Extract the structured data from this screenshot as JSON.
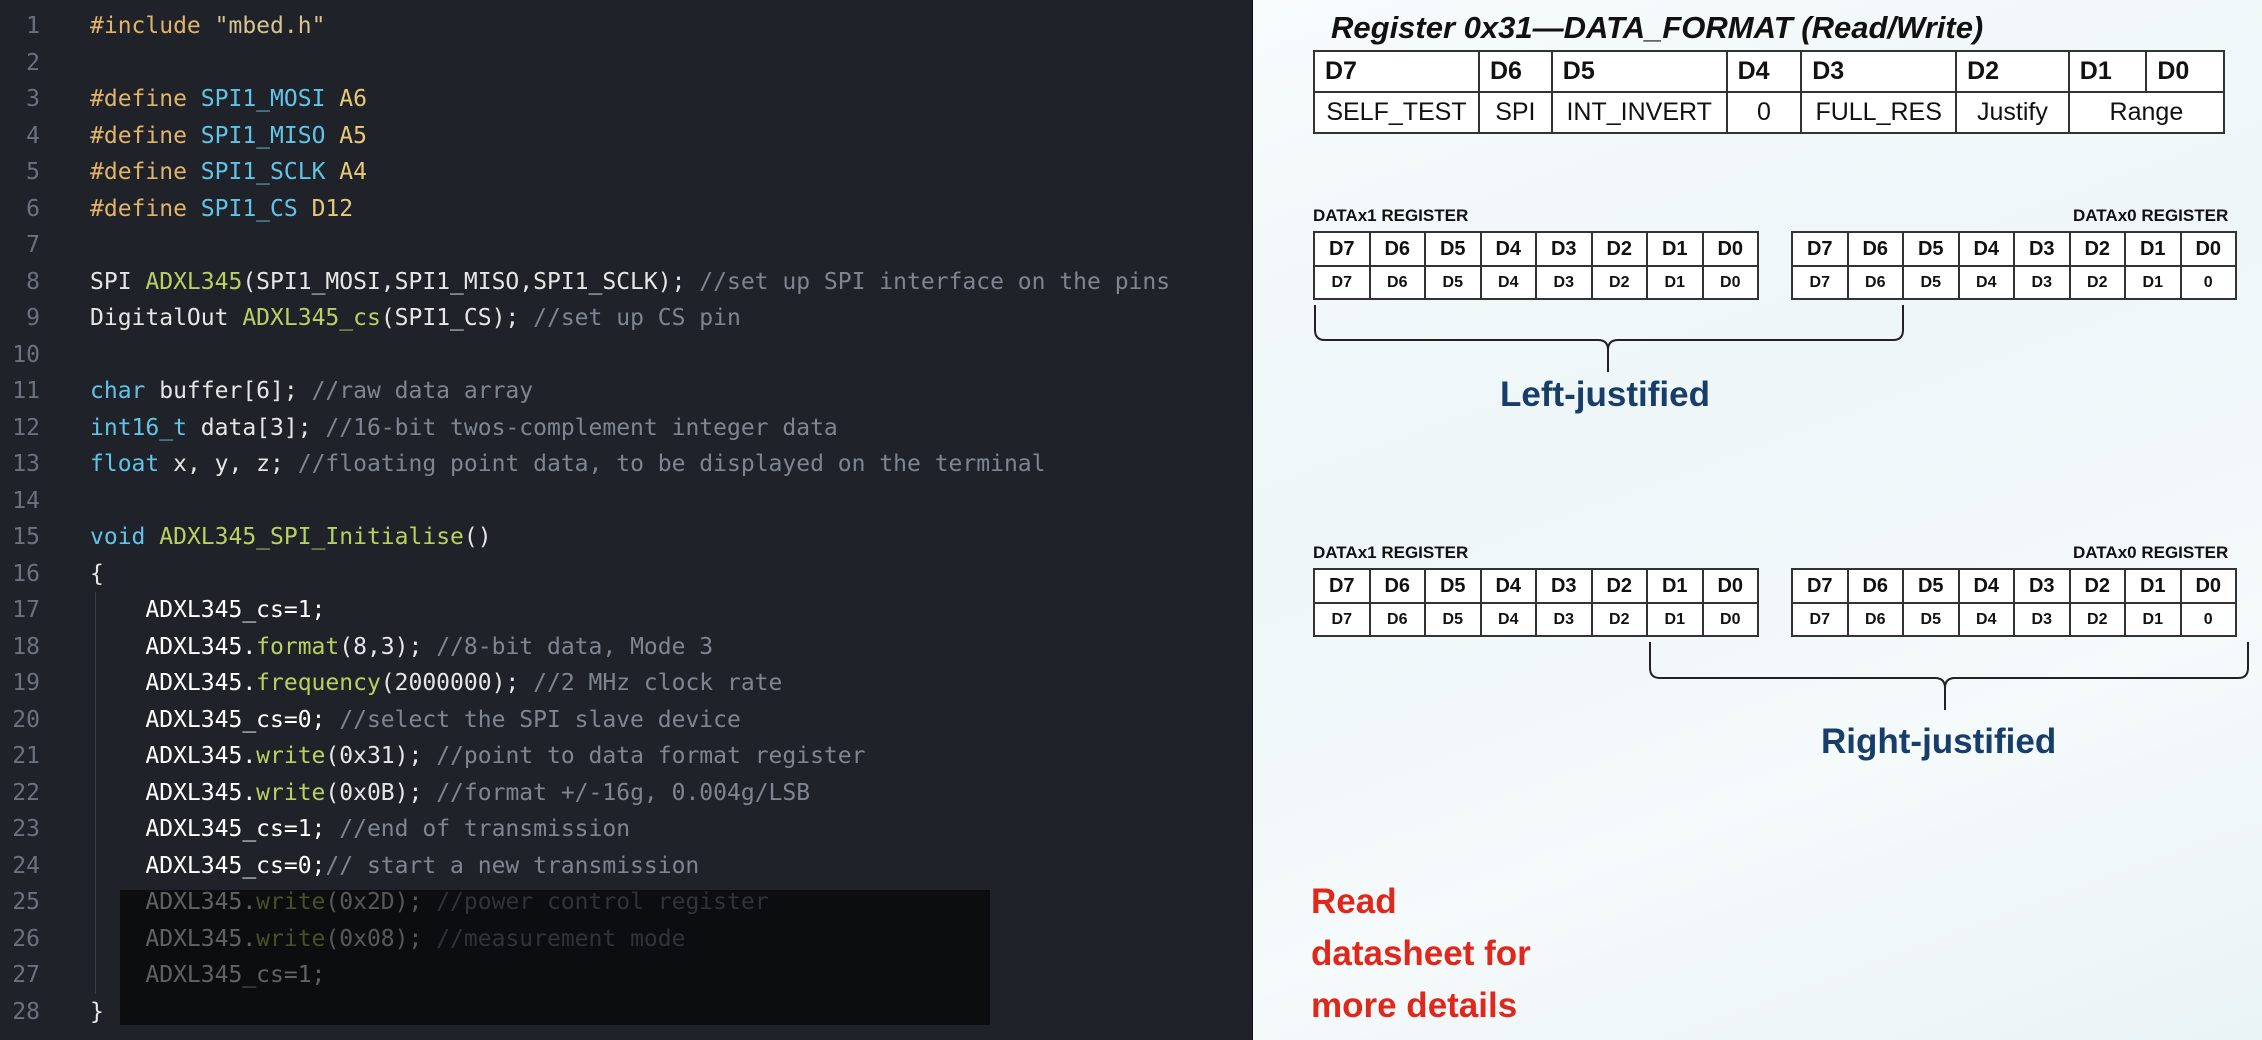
{
  "editor": {
    "lines": [
      {
        "n": "1",
        "html": "<span class=\"pp\">#include</span> <span class=\"str\">\"mbed.h\"</span>"
      },
      {
        "n": "2",
        "html": ""
      },
      {
        "n": "3",
        "html": "<span class=\"pp\">#define</span> <span class=\"mac\">SPI1_MOSI</span> <span class=\"num\">A6</span>"
      },
      {
        "n": "4",
        "html": "<span class=\"pp\">#define</span> <span class=\"mac\">SPI1_MISO</span> <span class=\"num\">A5</span>"
      },
      {
        "n": "5",
        "html": "<span class=\"pp\">#define</span> <span class=\"mac\">SPI1_SCLK</span> <span class=\"num\">A4</span>"
      },
      {
        "n": "6",
        "html": "<span class=\"pp\">#define</span> <span class=\"mac\">SPI1_CS</span> <span class=\"num\">D12</span>"
      },
      {
        "n": "7",
        "html": ""
      },
      {
        "n": "8",
        "html": "SPI <span class=\"fn\">ADXL345</span>(SPI1_MOSI,SPI1_MISO,SPI1_SCLK); <span class=\"cm\">//set up SPI interface on the pins</span>"
      },
      {
        "n": "9",
        "html": "DigitalOut <span class=\"fn\">ADXL345_cs</span>(SPI1_CS); <span class=\"cm\">//set up CS pin</span>"
      },
      {
        "n": "10",
        "html": ""
      },
      {
        "n": "11",
        "html": "<span class=\"kw\">char</span> buffer[6]; <span class=\"cm\">//raw data array</span>"
      },
      {
        "n": "12",
        "html": "<span class=\"kw\">int16_t</span> data[3]; <span class=\"cm\">//16-bit twos-complement integer data</span>"
      },
      {
        "n": "13",
        "html": "<span class=\"kw\">float</span> x, y, z; <span class=\"cm\">//floating point data, to be displayed on the terminal</span>"
      },
      {
        "n": "14",
        "html": ""
      },
      {
        "n": "15",
        "html": "<span class=\"kw\">void</span> <span class=\"fn\">ADXL345_SPI_Initialise</span>()"
      },
      {
        "n": "16",
        "html": "{"
      },
      {
        "n": "17",
        "html": "    <span class=\"hl\">ADXL345_cs=1;</span>",
        "indent": true
      },
      {
        "n": "18",
        "html": "    <span class=\"hl\">ADXL345.</span><span class=\"fn\">format</span>(8,3); <span class=\"cm\">//8-bit data, Mode 3</span>",
        "indent": true
      },
      {
        "n": "19",
        "html": "    <span class=\"hl\">ADXL345.</span><span class=\"fn\">frequency</span>(2000000); <span class=\"cm\">//2 MHz clock rate</span>",
        "indent": true
      },
      {
        "n": "20",
        "html": "    <span class=\"hl\">ADXL345_cs=0;</span> <span class=\"cm\">//select the SPI slave device</span>",
        "indent": true
      },
      {
        "n": "21",
        "html": "    <span class=\"hl\">ADXL345.</span><span class=\"fn\">write</span>(0x31); <span class=\"cm\">//point to data format register</span>",
        "indent": true
      },
      {
        "n": "22",
        "html": "    <span class=\"hl\">ADXL345.</span><span class=\"fn\">write</span>(0x0B); <span class=\"cm\">//format +/-16g, 0.004g/LSB</span>",
        "indent": true
      },
      {
        "n": "23",
        "html": "    <span class=\"hl\">ADXL345_cs=1;</span> <span class=\"cm\">//end of transmission</span>",
        "indent": true
      },
      {
        "n": "24",
        "html": "    <span class=\"hl\">ADXL345_cs=0;</span><span class=\"cm\">// start a new transmission</span>",
        "indent": true
      },
      {
        "n": "25",
        "html": "    <span class=\"hl\">ADXL345.</span><span class=\"fn\">write</span>(0x2D); <span class=\"cm\">//power control register</span>",
        "indent": true
      },
      {
        "n": "26",
        "html": "    <span class=\"hl\">ADXL345.</span><span class=\"fn\">write</span>(0x08); <span class=\"cm\">//measurement mode</span>",
        "indent": true
      },
      {
        "n": "27",
        "html": "    <span class=\"hl\">ADXL345_cs=1;</span>",
        "indent": true
      },
      {
        "n": "28",
        "html": "}"
      }
    ]
  },
  "datasheet": {
    "title": "Register 0x31—DATA_FORMAT (Read/Write)",
    "format_header": [
      "D7",
      "D6",
      "D5",
      "D4",
      "D3",
      "D2",
      "D1",
      "D0"
    ],
    "format_values": [
      "SELF_TEST",
      "SPI",
      "INT_INVERT",
      "0",
      "FULL_RES",
      "Justify",
      "Range"
    ],
    "datax1_label": "DATAx1 REGISTER",
    "datax0_label": "DATAx0 REGISTER",
    "bit_header": [
      "D7",
      "D6",
      "D5",
      "D4",
      "D3",
      "D2",
      "D1",
      "D0"
    ],
    "x1_bits_left": [
      "D7",
      "D6",
      "D5",
      "D4",
      "D3",
      "D2",
      "D1",
      "D0"
    ],
    "x0_bits_left": [
      "D7",
      "D6",
      "D5",
      "D4",
      "D3",
      "D2",
      "D1",
      "0"
    ],
    "x1_bits_right": [
      "D7",
      "D6",
      "D5",
      "D4",
      "D3",
      "D2",
      "D1",
      "D0"
    ],
    "x0_bits_right": [
      "D7",
      "D6",
      "D5",
      "D4",
      "D3",
      "D2",
      "D1",
      "0"
    ],
    "left_justified": "Left-justified",
    "right_justified": "Right-justified",
    "note_lines": [
      "Read",
      "datasheet for",
      "more details"
    ]
  }
}
